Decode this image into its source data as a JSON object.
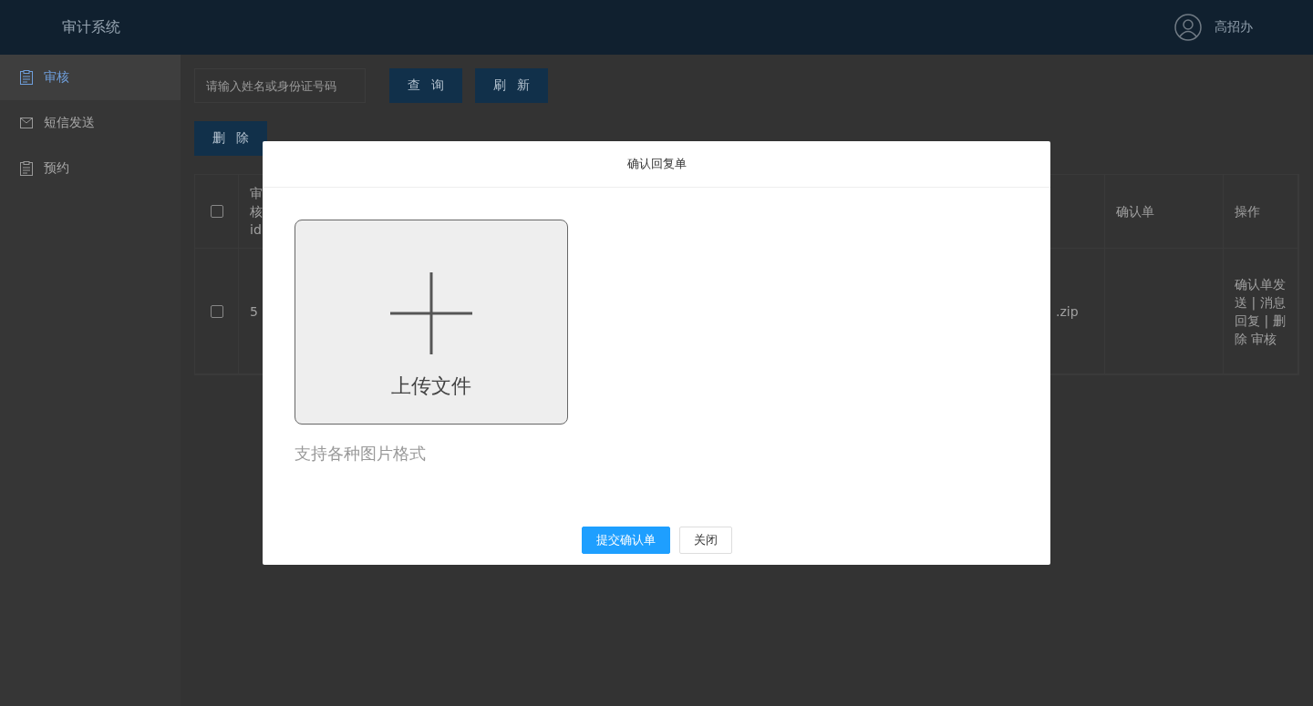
{
  "header": {
    "title": "审计系统",
    "user": "高招办"
  },
  "sidebar": {
    "items": [
      {
        "label": "审核",
        "selected": true
      },
      {
        "label": "短信发送",
        "selected": false
      },
      {
        "label": "预约",
        "selected": false
      }
    ]
  },
  "toolbar": {
    "search": {
      "placeholder": "请输入姓名或身份证号码"
    },
    "buttons": [
      "查询",
      "刷新"
    ],
    "delete_button": "删除"
  },
  "table": {
    "all_selected": false,
    "columns": [
      "审核id",
      "",
      "确认单",
      "操作"
    ],
    "rows": [
      {
        "selected": false,
        "cells": [
          "5",
          ".zip",
          "",
          "确认单发送 | 消息回复 | 删除 审核"
        ]
      }
    ]
  },
  "dialog": {
    "title": "确认回复单",
    "upload_label": "上传文件",
    "hint": "支持各种图片格式",
    "buttons": [
      {
        "label": "提交确认单",
        "kind": "primary"
      },
      {
        "label": "关闭",
        "kind": "plain"
      }
    ]
  }
}
